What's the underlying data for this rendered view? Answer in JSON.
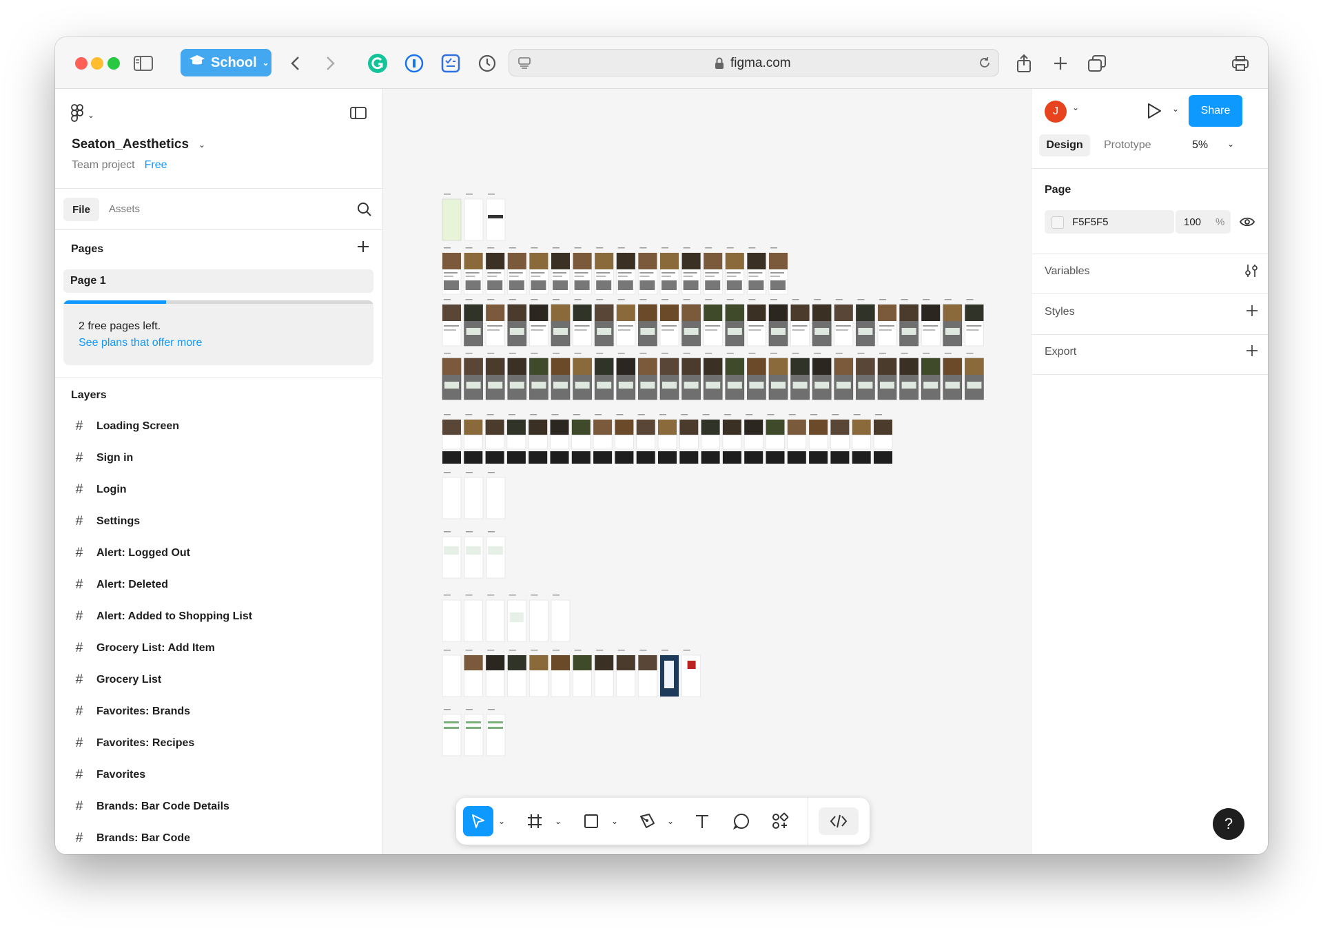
{
  "browser": {
    "school_label": "School",
    "url": "figma.com"
  },
  "file": {
    "name": "Seaton_Aesthetics",
    "team_label": "Team project",
    "plan_badge": "Free",
    "tabs": [
      "File",
      "Assets"
    ]
  },
  "pages": {
    "header": "Pages",
    "items": [
      "Page 1"
    ],
    "free_left_text": "2 free pages left.",
    "see_plans_link": "See plans that offer more",
    "usage_fraction": 0.33
  },
  "layers": {
    "header": "Layers",
    "items": [
      "Loading Screen",
      "Sign in",
      "Login",
      "Settings",
      "Alert: Logged Out",
      "Alert: Deleted",
      "Alert: Added to Shopping List",
      "Grocery List: Add Item",
      "Grocery List",
      "Favorites: Brands",
      "Favorites: Recipes",
      "Favorites",
      "Brands: Bar Code Details",
      "Brands: Bar Code"
    ]
  },
  "right_panel": {
    "avatar_initial": "J",
    "share_label": "Share",
    "tabs": [
      "Design",
      "Prototype"
    ],
    "zoom": "5%",
    "page_section": "Page",
    "page_color_hex": "F5F5F5",
    "page_opacity": "100",
    "percent_sign": "%",
    "sections": [
      "Variables",
      "Styles",
      "Export"
    ]
  },
  "help_label": "?",
  "colors": {
    "accent": "#0d99ff",
    "canvas_bg": "#f5f5f5",
    "avatar": "#e8431f",
    "school": "#43a8f0"
  }
}
